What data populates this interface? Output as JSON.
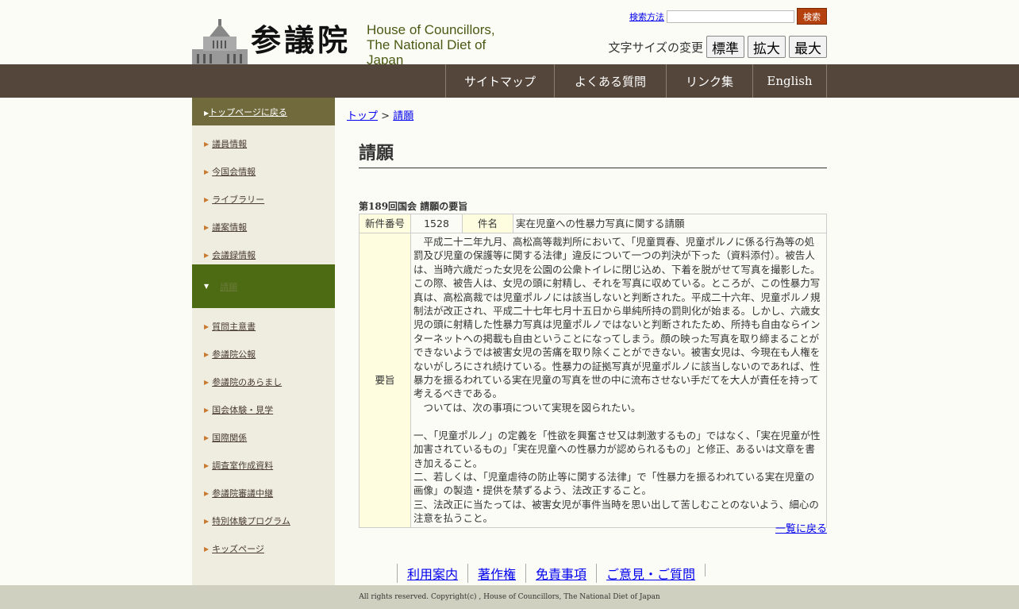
{
  "header": {
    "logo_kanji": "参議院",
    "logo_en_1": "House of Councillors,",
    "logo_en_2": "The National Diet of Japan",
    "search_help": "検索方法",
    "search_value": "",
    "search_button": "検索",
    "fontsize_label": "文字サイズの変更",
    "fontsize_buttons": [
      "標準",
      "拡大",
      "最大"
    ]
  },
  "nav": [
    {
      "label": "サイトマップ"
    },
    {
      "label": "よくある質問"
    },
    {
      "label": "リンク集"
    },
    {
      "label": "English"
    }
  ],
  "sidebar": {
    "top": "トップページに戻る",
    "items_before": [
      "議員情報",
      "今国会情報",
      "ライブラリー",
      "議案情報",
      "会議録情報"
    ],
    "active": "請願",
    "items_after": [
      "質問主意書",
      "参議院公報",
      "参議院のあらまし",
      "国会体験・見学",
      "国際関係",
      "調査室作成資料",
      "参議院審議中継",
      "特別体験プログラム",
      "キッズページ"
    ]
  },
  "breadcrumb": {
    "home": "トップ",
    "sep": " > ",
    "current": "請願"
  },
  "page_title": "請願",
  "subtitle": "第189回国会 請願の要旨",
  "table": {
    "h_number": "新件番号",
    "number": "1528",
    "h_subject": "件名",
    "subject": "実在児童への性暴力写真に関する請願",
    "h_summary": "要旨",
    "summary": "　平成二十二年九月、高松高等裁判所において、「児童買春、児童ポルノに係る行為等の処罰及び児童の保護等に関する法律」違反について一つの判決が下った（資料添付）。被告人は、当時六歳だった女児を公園の公衆トイレに閉じ込め、下着を脱がせて写真を撮影した。この際、被告人は、女児の頭に射精し、それを写真に収めている。ところが、この性暴力写真は、高松高裁では児童ポルノには該当しないと判断された。平成二十六年、児童ポルノ規制法が改正され、平成二十七年七月十五日から単純所持の罰則化が始まる。しかし、六歳女児の頭に射精した性暴力写真は児童ポルノではないと判断されたため、所持も自由ならインターネットへの掲載も自由ということになってしまう。顔の映った写真を取り締まることができないようでは被害女児の苦痛を取り除くことができない。被害女児は、今現在も人権をないがしろにされ続けている。性暴力の証拠写真が児童ポルノに該当しないのであれば、性暴力を振るわれている実在児童の写真を世の中に流布させない手だてを大人が責任を持って考えるべきである。\n　ついては、次の事項について実現を図られたい。\n\n一、「児童ポルノ」の定義を「性欲を興奮させ又は刺激するもの」ではなく、「実在児童が性加害されているもの」「実在児童への性暴力が認められるもの」と修正、あるいは文章を書き加えること。\n二、若しくは、「児童虐待の防止等に関する法律」で「性暴力を振るわれている実在児童の画像」の製造・提供を禁ずるよう、法改正すること。\n三、法改正に当たっては、被害女児が事件当時を思い出して苦しむことのないよう、細心の注意を払うこと。"
  },
  "back_link": "一覧に戻る",
  "footer_links": [
    "利用案内",
    "著作権",
    "免責事項",
    "ご意見・ご質問"
  ],
  "copyright": "All rights reserved. Copyright(c) , House of Councillors, The National Diet of Japan"
}
